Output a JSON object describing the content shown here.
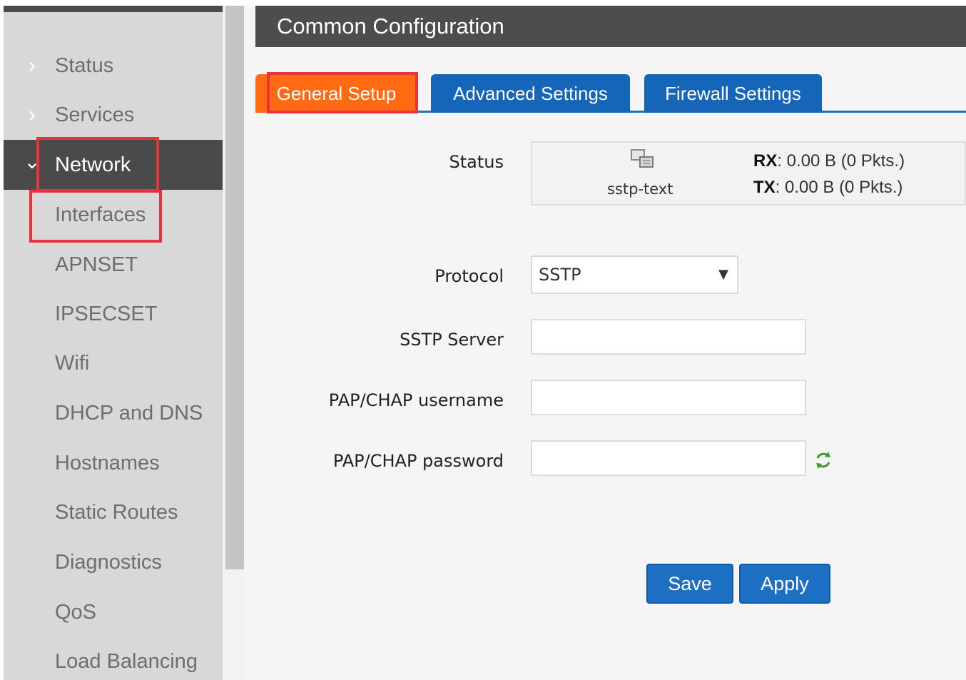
{
  "sidebar": {
    "items": [
      {
        "label": "Status",
        "chevron": "›"
      },
      {
        "label": "Services",
        "chevron": "›"
      },
      {
        "label": "Network",
        "chevron": "⌄"
      }
    ],
    "subitems": [
      {
        "label": "Interfaces"
      },
      {
        "label": "APNSET"
      },
      {
        "label": "IPSECSET"
      },
      {
        "label": "Wifi"
      },
      {
        "label": "DHCP and DNS"
      },
      {
        "label": "Hostnames"
      },
      {
        "label": "Static Routes"
      },
      {
        "label": "Diagnostics"
      },
      {
        "label": "QoS"
      },
      {
        "label": "Load Balancing"
      }
    ]
  },
  "main": {
    "title": "Common Configuration",
    "tabs": [
      {
        "label": "General Setup"
      },
      {
        "label": "Advanced Settings"
      },
      {
        "label": "Firewall Settings"
      }
    ],
    "status": {
      "label": "Status",
      "interface": "sstp-text",
      "rx_label": "RX",
      "rx_value": ": 0.00 B (0 Pkts.)",
      "tx_label": "TX",
      "tx_value": ": 0.00 B (0 Pkts.)"
    },
    "protocol": {
      "label": "Protocol",
      "value": "SSTP",
      "arrow": "▼"
    },
    "sstp_server": {
      "label": "SSTP Server",
      "value": ""
    },
    "username": {
      "label": "PAP/CHAP username",
      "value": ""
    },
    "password": {
      "label": "PAP/CHAP password",
      "value": ""
    },
    "buttons": {
      "save": "Save",
      "apply": "Apply"
    }
  },
  "colors": {
    "active_tab": "#ff6a13",
    "tab": "#1565b8",
    "header": "#4d4d4d",
    "highlight": "#e8333a",
    "button": "#1d6fc4"
  }
}
